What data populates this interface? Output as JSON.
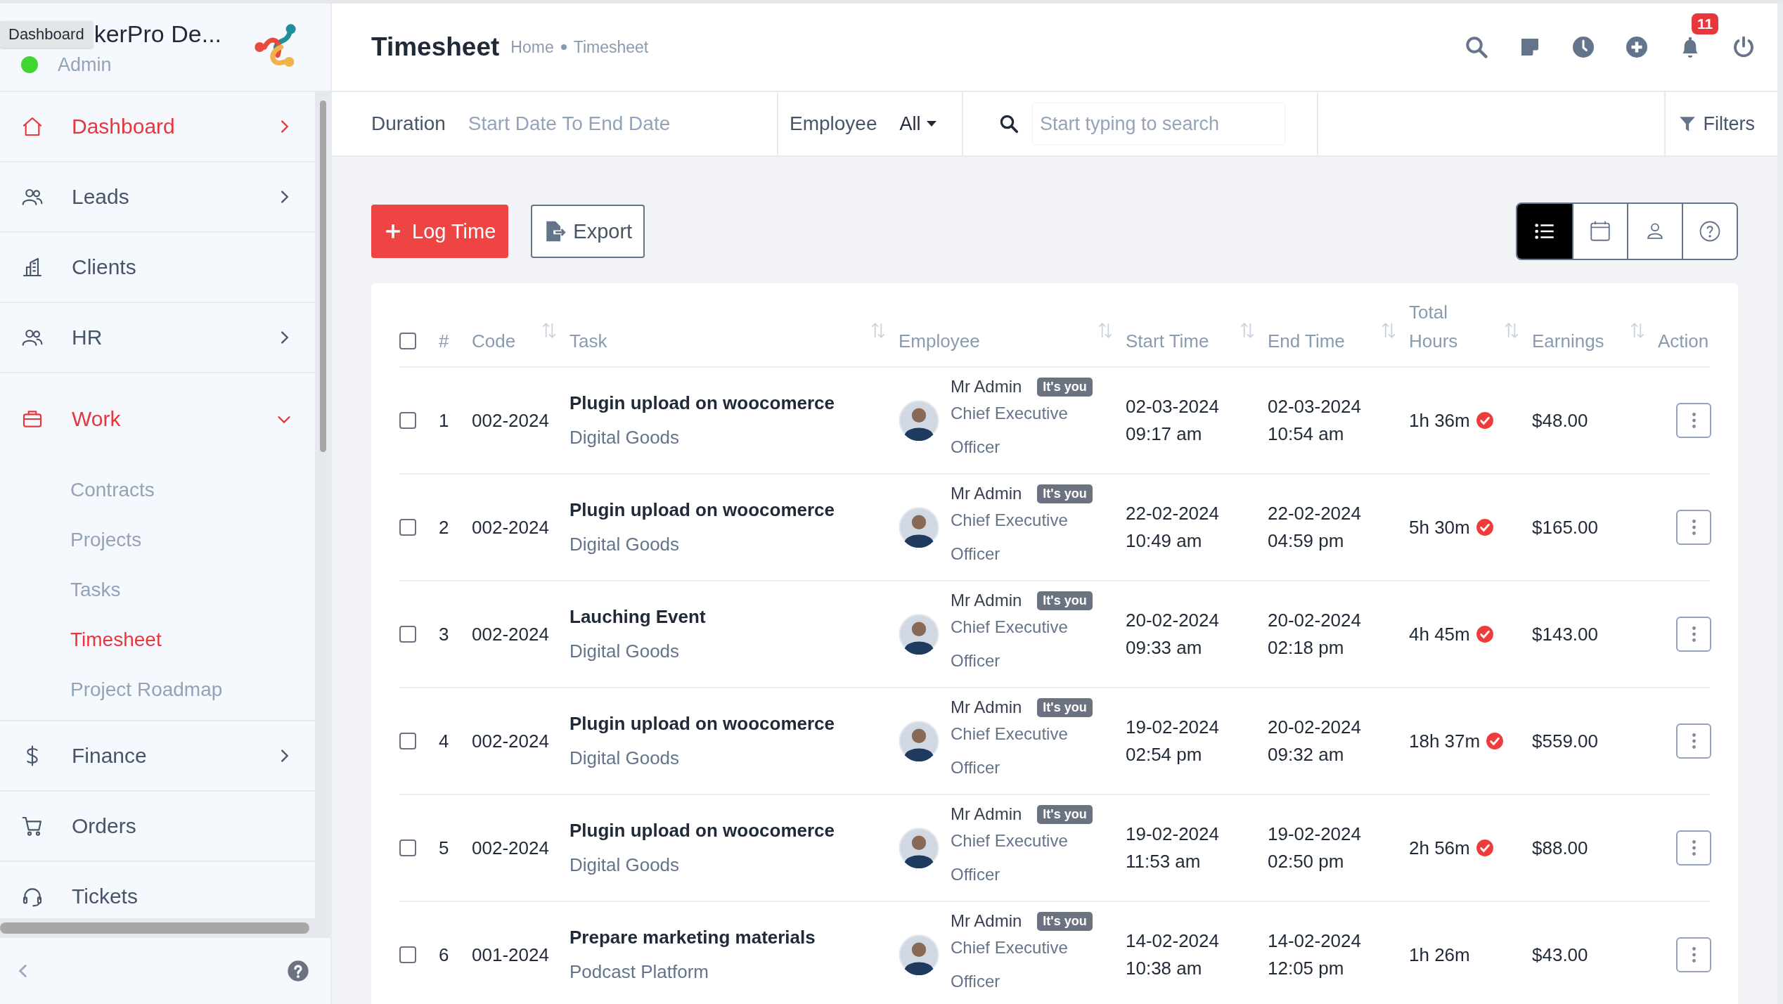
{
  "sidebar": {
    "tooltip": "Dashboard",
    "brand_title": "kerPro De...",
    "role": "Admin",
    "online": true,
    "items": [
      {
        "label": "Dashboard",
        "kind": "home",
        "selected": true,
        "expanded": false
      },
      {
        "label": "Leads",
        "kind": "users",
        "selected": false,
        "expanded": false
      },
      {
        "label": "Clients",
        "kind": "building",
        "selected": false
      },
      {
        "label": "HR",
        "kind": "users",
        "selected": false,
        "expanded": false
      },
      {
        "label": "Work",
        "kind": "briefcase",
        "selected": true,
        "expanded": true,
        "children": [
          {
            "label": "Contracts",
            "selected": false
          },
          {
            "label": "Projects",
            "selected": false
          },
          {
            "label": "Tasks",
            "selected": false
          },
          {
            "label": "Timesheet",
            "selected": true
          },
          {
            "label": "Project Roadmap",
            "selected": false
          }
        ]
      },
      {
        "label": "Finance",
        "kind": "dollar",
        "selected": false,
        "expanded": false
      },
      {
        "label": "Orders",
        "kind": "cart",
        "selected": false
      },
      {
        "label": "Tickets",
        "kind": "headset",
        "selected": false
      }
    ]
  },
  "topbar": {
    "title": "Timesheet",
    "breadcrumb": [
      "Home",
      "Timesheet"
    ],
    "icons": [
      {
        "kind": "search"
      },
      {
        "kind": "note"
      },
      {
        "kind": "clock"
      },
      {
        "kind": "add"
      },
      {
        "kind": "bell",
        "badge": "11"
      },
      {
        "kind": "power"
      }
    ]
  },
  "filters": {
    "duration_label": "Duration",
    "duration_value": "Start Date To End Date",
    "employee_label": "Employee",
    "employee_value": "All",
    "search_placeholder": "Start typing to search",
    "filters_button": "Filters"
  },
  "toolbar": {
    "log_time": "Log Time",
    "export": "Export",
    "views": [
      {
        "kind": "list",
        "selected": true
      },
      {
        "kind": "calendar",
        "selected": false
      },
      {
        "kind": "user",
        "selected": false
      },
      {
        "kind": "help",
        "selected": false
      }
    ]
  },
  "table": {
    "select_all_checked": false,
    "columns": [
      {
        "label": "#"
      },
      {
        "label": "Code",
        "sortable": true
      },
      {
        "label": "Task",
        "sortable": true
      },
      {
        "label": "Employee",
        "sortable": true
      },
      {
        "label": "Start Time",
        "sortable": true
      },
      {
        "label": "End Time",
        "sortable": true
      },
      {
        "label": "Total Hours",
        "sortable": true
      },
      {
        "label": "Earnings",
        "sortable": true
      },
      {
        "label": "Action"
      }
    ],
    "rows": [
      {
        "checked": false,
        "number": "1",
        "code": "002-2024",
        "task": "Plugin upload on woocomerce",
        "project": "Digital Goods",
        "employee": "Mr Admin",
        "badge": "It's you",
        "designation": "Chief Executive Officer",
        "start_date": "02-03-2024",
        "start_time": "09:17 am",
        "end_date": "02-03-2024",
        "end_time": "10:54 am",
        "total": "1h 36m",
        "approved": true,
        "earnings": "$48.00"
      },
      {
        "checked": false,
        "number": "2",
        "code": "002-2024",
        "task": "Plugin upload on woocomerce",
        "project": "Digital Goods",
        "employee": "Mr Admin",
        "badge": "It's you",
        "designation": "Chief Executive Officer",
        "start_date": "22-02-2024",
        "start_time": "10:49 am",
        "end_date": "22-02-2024",
        "end_time": "04:59 pm",
        "total": "5h 30m",
        "approved": true,
        "earnings": "$165.00"
      },
      {
        "checked": false,
        "number": "3",
        "code": "002-2024",
        "task": "Lauching Event",
        "project": "Digital Goods",
        "employee": "Mr Admin",
        "badge": "It's you",
        "designation": "Chief Executive Officer",
        "start_date": "20-02-2024",
        "start_time": "09:33 am",
        "end_date": "20-02-2024",
        "end_time": "02:18 pm",
        "total": "4h 45m",
        "approved": true,
        "earnings": "$143.00"
      },
      {
        "checked": false,
        "number": "4",
        "code": "002-2024",
        "task": "Plugin upload on woocomerce",
        "project": "Digital Goods",
        "employee": "Mr Admin",
        "badge": "It's you",
        "designation": "Chief Executive Officer",
        "start_date": "19-02-2024",
        "start_time": "02:54 pm",
        "end_date": "20-02-2024",
        "end_time": "09:32 am",
        "total": "18h 37m",
        "approved": true,
        "earnings": "$559.00"
      },
      {
        "checked": false,
        "number": "5",
        "code": "002-2024",
        "task": "Plugin upload on woocomerce",
        "project": "Digital Goods",
        "employee": "Mr Admin",
        "badge": "It's you",
        "designation": "Chief Executive Officer",
        "start_date": "19-02-2024",
        "start_time": "11:53 am",
        "end_date": "19-02-2024",
        "end_time": "02:50 pm",
        "total": "2h 56m",
        "approved": true,
        "earnings": "$88.00"
      },
      {
        "checked": false,
        "number": "6",
        "code": "001-2024",
        "task": "Prepare marketing materials",
        "project": "Podcast Platform",
        "employee": "Mr Admin",
        "badge": "It's you",
        "designation": "Chief Executive Officer",
        "start_date": "14-02-2024",
        "start_time": "10:38 am",
        "end_date": "14-02-2024",
        "end_time": "12:05 pm",
        "total": "1h 26m",
        "approved": false,
        "earnings": "$43.00"
      }
    ]
  }
}
